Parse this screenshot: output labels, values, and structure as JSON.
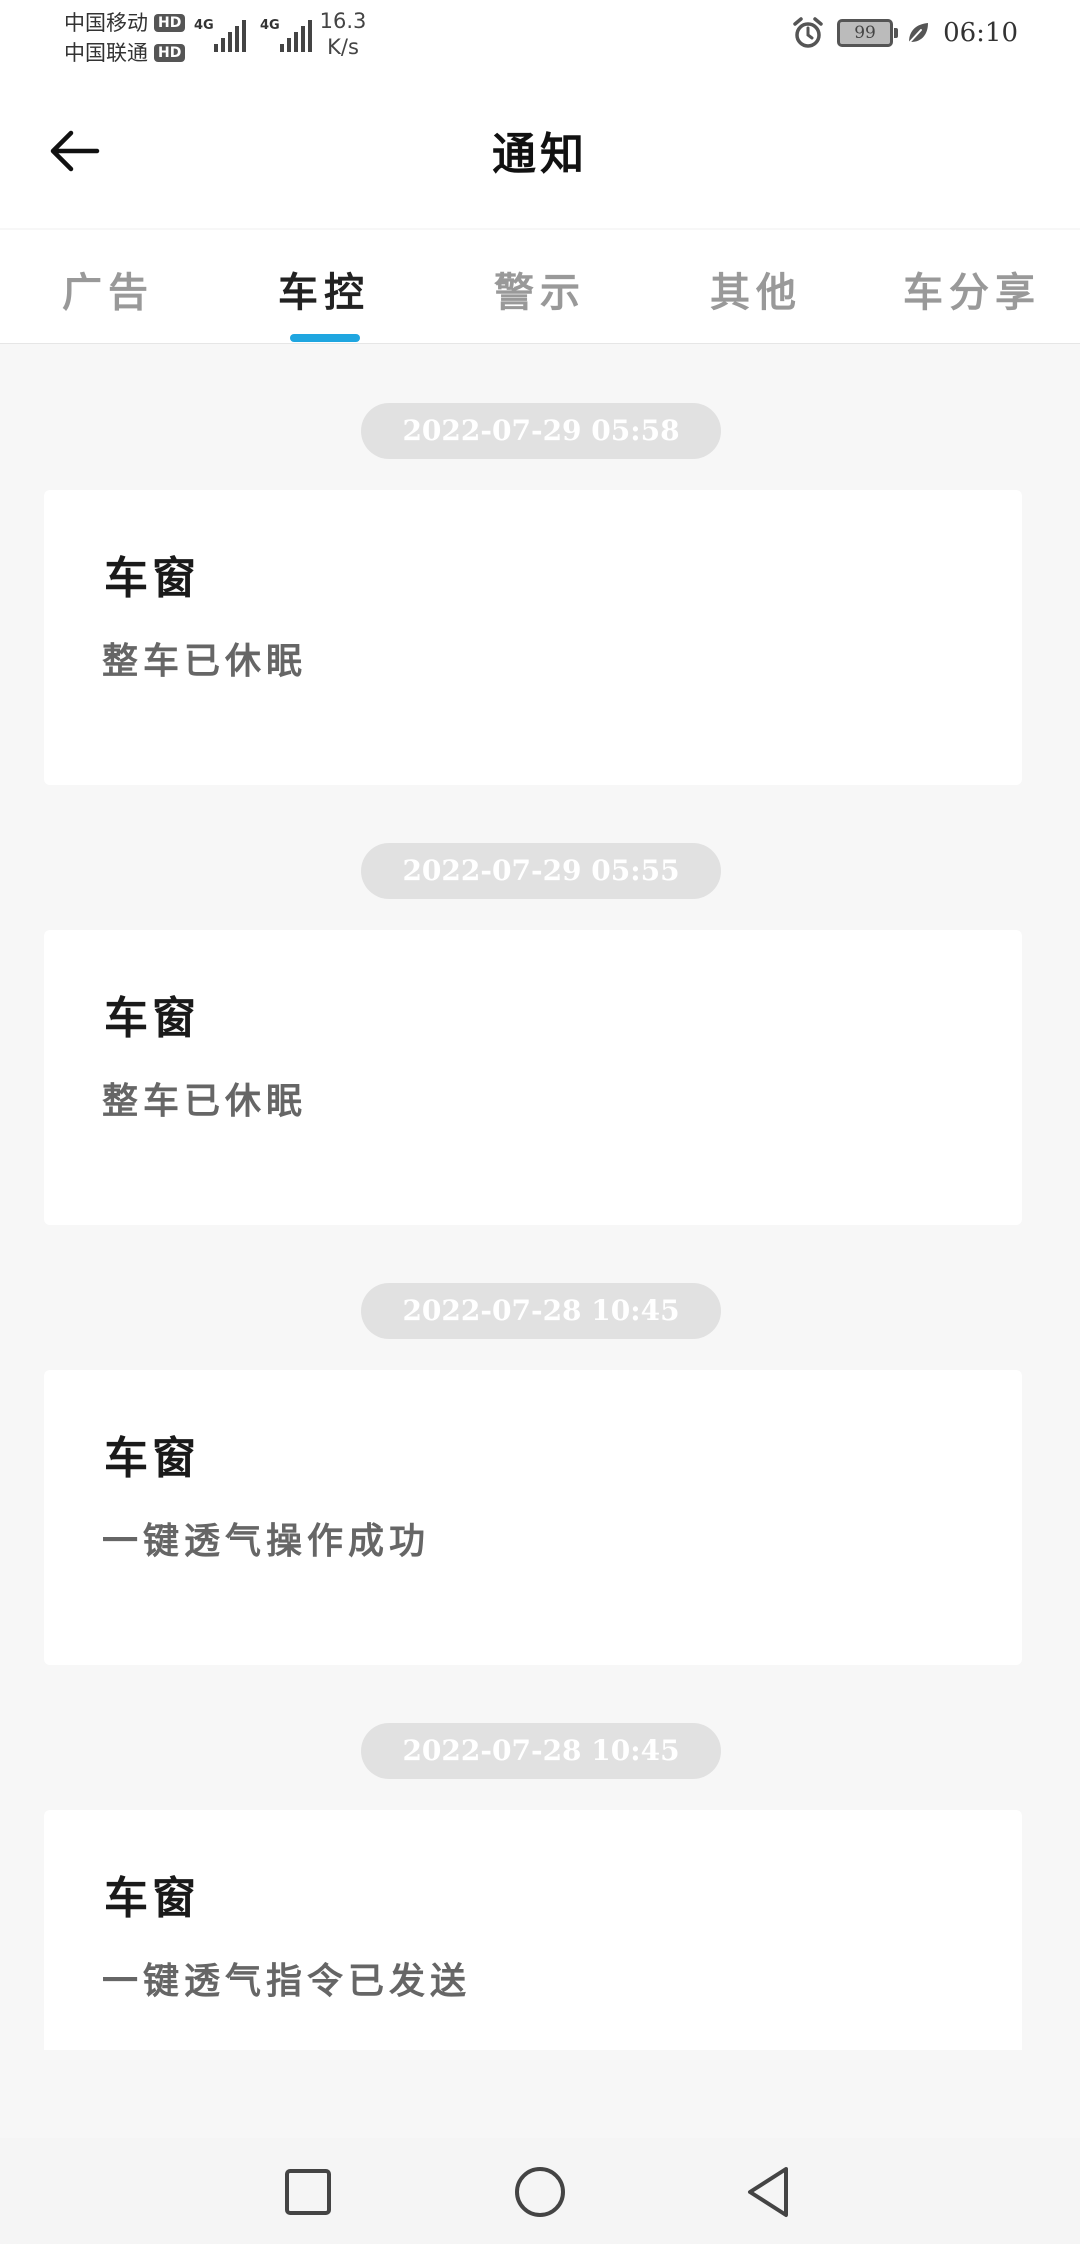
{
  "status_bar": {
    "carrier_1": "中国移动",
    "carrier_2": "中国联通",
    "hd_label": "HD",
    "network_1": "4G",
    "network_2": "4G",
    "speed_value": "16.3",
    "speed_unit": "K/s",
    "battery_level": "99",
    "time": "06:10"
  },
  "header": {
    "title": "通知"
  },
  "tabs": [
    {
      "label": "广告"
    },
    {
      "label": "车控"
    },
    {
      "label": "警示"
    },
    {
      "label": "其他"
    },
    {
      "label": "车分享"
    }
  ],
  "active_tab": "车控",
  "notifications": [
    {
      "time": "2022-07-29 05:58",
      "title": "车窗",
      "body": "整车已休眠"
    },
    {
      "time": "2022-07-29 05:55",
      "title": "车窗",
      "body": "整车已休眠"
    },
    {
      "time": "2022-07-28 10:45",
      "title": "车窗",
      "body": "一键透气操作成功"
    },
    {
      "time": "2022-07-28 10:45",
      "title": "车窗",
      "body": "一键透气指令已发送"
    }
  ],
  "colors": {
    "accent": "#1fa6e0",
    "background": "#f7f7f7",
    "pill": "#e1e1e1"
  },
  "icons": {
    "back": "arrow-left-icon",
    "alarm": "alarm-clock-icon",
    "eco": "leaf-icon",
    "nav_recent": "square-icon",
    "nav_home": "circle-icon",
    "nav_back": "triangle-back-icon"
  }
}
